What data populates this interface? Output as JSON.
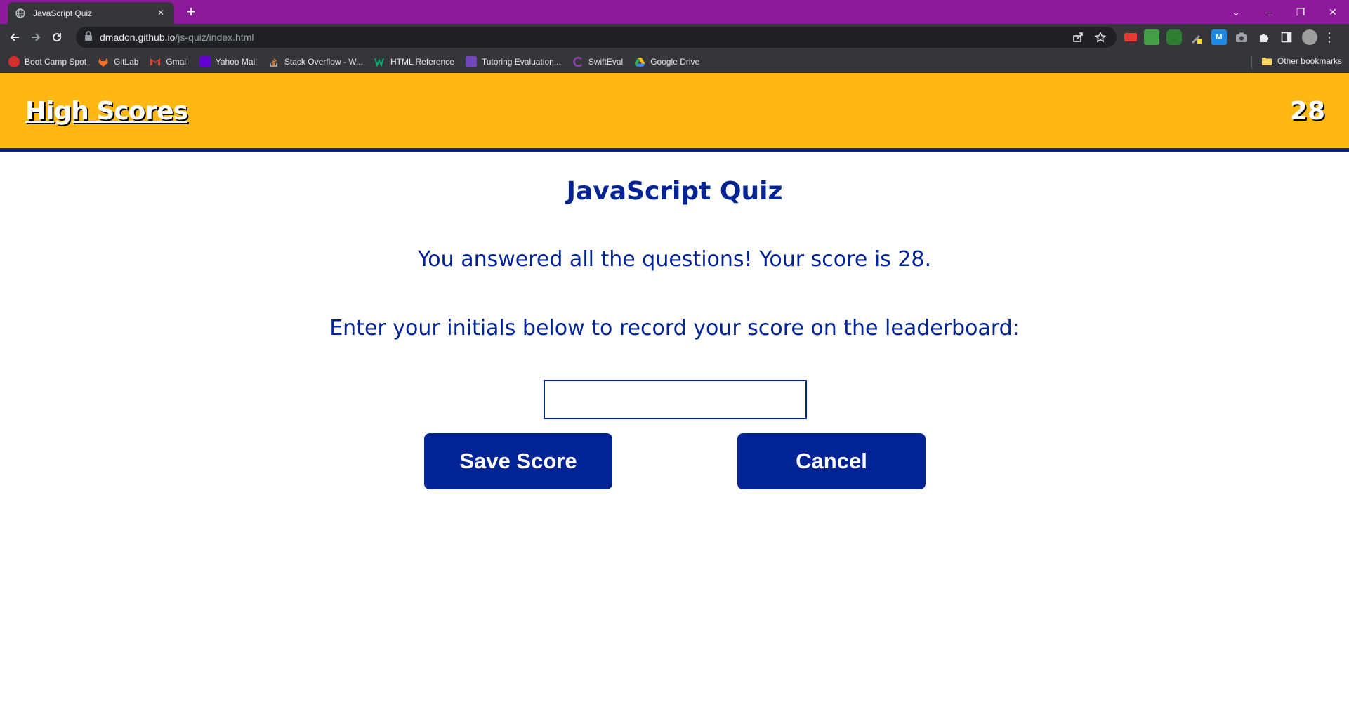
{
  "browser": {
    "tab_title": "JavaScript Quiz",
    "tab_close": "×",
    "new_tab": "+",
    "url_host": "dmadon.github.io",
    "url_path": "/js-quiz/index.html",
    "window": {
      "minimize": "–",
      "restore": "❐",
      "close": "✕",
      "search_tabs": "⌄"
    },
    "menu": "⋮",
    "extensions": [
      {
        "name": "extension-red",
        "color": "#e53935"
      },
      {
        "name": "extension-green-box",
        "color": "#43a047"
      },
      {
        "name": "extension-green-shield",
        "color": "#2e7d32"
      },
      {
        "name": "extension-pen",
        "color": "#fdd835"
      },
      {
        "name": "extension-m",
        "color": "#1e88e5",
        "letter": "M"
      },
      {
        "name": "extension-camera",
        "color": "#757575"
      }
    ]
  },
  "bookmarks": [
    {
      "label": "Boot Camp Spot",
      "icon": "bootcamp-icon",
      "color": "#d32f2f"
    },
    {
      "label": "GitLab",
      "icon": "gitlab-icon",
      "color": "#fc6d26"
    },
    {
      "label": "Gmail",
      "icon": "gmail-icon",
      "color": "#ea4335"
    },
    {
      "label": "Yahoo Mail",
      "icon": "yahoo-icon",
      "color": "#6001d2"
    },
    {
      "label": "Stack Overflow - W...",
      "icon": "stackoverflow-icon",
      "color": "#f48024"
    },
    {
      "label": "HTML Reference",
      "icon": "html-reference-icon",
      "color": "#04aa6d"
    },
    {
      "label": "Tutoring Evaluation...",
      "icon": "forms-icon",
      "color": "#7248b9"
    },
    {
      "label": "SwiftEval",
      "icon": "swifteval-icon",
      "color": "#8e44ad"
    },
    {
      "label": "Google Drive",
      "icon": "google-drive-icon",
      "color": "#34a853"
    }
  ],
  "other_bookmarks": "Other bookmarks",
  "header": {
    "high_scores_label": "High Scores",
    "timer": "28",
    "bg_color": "#ffb812",
    "accent_color": "#012394"
  },
  "main": {
    "title": "JavaScript Quiz",
    "score_message": "You answered all the questions! Your score is 28.",
    "initials_prompt": "Enter your initials below to record your score on the leaderboard:",
    "initials_value": "",
    "save_label": "Save Score",
    "cancel_label": "Cancel"
  }
}
